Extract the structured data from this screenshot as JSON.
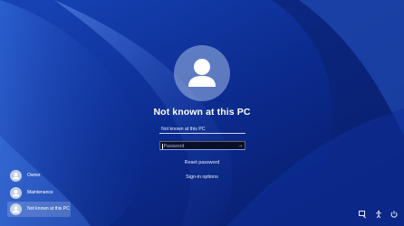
{
  "login": {
    "username": "Not known at this PC",
    "username_field_value": "Not known at this PC",
    "password_placeholder": "Password",
    "submit_icon": "arrow-right-icon",
    "reset_password": "Reset password",
    "sign_in_options": "Sign-in options"
  },
  "user_list": [
    {
      "label": "Owner",
      "selected": false
    },
    {
      "label": "Maintenance",
      "selected": false
    },
    {
      "label": "Not known at this PC",
      "selected": true
    }
  ],
  "system_buttons": [
    {
      "icon": "display-icon"
    },
    {
      "icon": "accessibility-icon"
    },
    {
      "icon": "power-icon"
    }
  ],
  "colors": {
    "background": "#0b2a8a",
    "bloom_light": "#5f8ff0",
    "field_dark": "#0a0f24",
    "focus_accent": "#7fa2ff"
  }
}
